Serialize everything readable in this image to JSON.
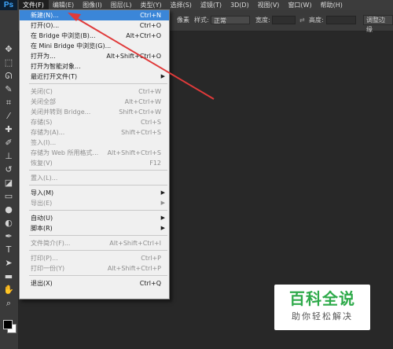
{
  "app": {
    "logo": "Ps"
  },
  "menubar": {
    "items": [
      {
        "label": "文件(F)"
      },
      {
        "label": "编辑(E)"
      },
      {
        "label": "图像(I)"
      },
      {
        "label": "图层(L)"
      },
      {
        "label": "类型(Y)"
      },
      {
        "label": "选择(S)"
      },
      {
        "label": "滤镜(T)"
      },
      {
        "label": "3D(D)"
      },
      {
        "label": "视图(V)"
      },
      {
        "label": "窗口(W)"
      },
      {
        "label": "帮助(H)"
      }
    ]
  },
  "options_bar": {
    "feather_unit": "像素",
    "style_label": "样式:",
    "style_value": "正常",
    "width_label": "宽度:",
    "height_label": "高度:",
    "refine_button": "调整边缘"
  },
  "file_menu": {
    "items": [
      {
        "label": "新建(N)...",
        "shortcut": "Ctrl+N",
        "state": "highlighted"
      },
      {
        "label": "打开(O)...",
        "shortcut": "Ctrl+O",
        "state": "enabled"
      },
      {
        "label": "在 Bridge 中浏览(B)...",
        "shortcut": "Alt+Ctrl+O",
        "state": "enabled"
      },
      {
        "label": "在 Mini Bridge 中浏览(G)...",
        "shortcut": "",
        "state": "enabled"
      },
      {
        "label": "打开为...",
        "shortcut": "Alt+Shift+Ctrl+O",
        "state": "enabled"
      },
      {
        "label": "打开为智能对象...",
        "shortcut": "",
        "state": "enabled"
      },
      {
        "label": "最近打开文件(T)",
        "shortcut": "",
        "state": "enabled",
        "submenu": true
      },
      {
        "separator": true
      },
      {
        "label": "关闭(C)",
        "shortcut": "Ctrl+W",
        "state": "disabled"
      },
      {
        "label": "关闭全部",
        "shortcut": "Alt+Ctrl+W",
        "state": "disabled"
      },
      {
        "label": "关闭并转到 Bridge...",
        "shortcut": "Shift+Ctrl+W",
        "state": "disabled"
      },
      {
        "label": "存储(S)",
        "shortcut": "Ctrl+S",
        "state": "disabled"
      },
      {
        "label": "存储为(A)...",
        "shortcut": "Shift+Ctrl+S",
        "state": "disabled"
      },
      {
        "label": "签入(I)...",
        "shortcut": "",
        "state": "disabled"
      },
      {
        "label": "存储为 Web 所用格式...",
        "shortcut": "Alt+Shift+Ctrl+S",
        "state": "disabled"
      },
      {
        "label": "恢复(V)",
        "shortcut": "F12",
        "state": "disabled"
      },
      {
        "separator": true
      },
      {
        "label": "置入(L)...",
        "shortcut": "",
        "state": "disabled"
      },
      {
        "separator": true
      },
      {
        "label": "导入(M)",
        "shortcut": "",
        "state": "enabled",
        "submenu": true
      },
      {
        "label": "导出(E)",
        "shortcut": "",
        "state": "disabled",
        "submenu": true
      },
      {
        "separator": true
      },
      {
        "label": "自动(U)",
        "shortcut": "",
        "state": "enabled",
        "submenu": true
      },
      {
        "label": "脚本(R)",
        "shortcut": "",
        "state": "enabled",
        "submenu": true
      },
      {
        "separator": true
      },
      {
        "label": "文件简介(F)...",
        "shortcut": "Alt+Shift+Ctrl+I",
        "state": "disabled"
      },
      {
        "separator": true
      },
      {
        "label": "打印(P)...",
        "shortcut": "Ctrl+P",
        "state": "disabled"
      },
      {
        "label": "打印一份(Y)",
        "shortcut": "Alt+Shift+Ctrl+P",
        "state": "disabled"
      },
      {
        "separator": true
      },
      {
        "label": "退出(X)",
        "shortcut": "Ctrl+Q",
        "state": "enabled"
      }
    ]
  },
  "toolbar": {
    "tools": [
      {
        "icon": "move-tool-icon",
        "glyph": "✥"
      },
      {
        "icon": "marquee-tool-icon",
        "glyph": "⬚"
      },
      {
        "icon": "lasso-tool-icon",
        "glyph": "ᘏ"
      },
      {
        "icon": "quick-select-tool-icon",
        "glyph": "✎"
      },
      {
        "icon": "crop-tool-icon",
        "glyph": "⌗"
      },
      {
        "icon": "eyedropper-tool-icon",
        "glyph": "⁄"
      },
      {
        "icon": "healing-brush-tool-icon",
        "glyph": "✚"
      },
      {
        "icon": "brush-tool-icon",
        "glyph": "✐"
      },
      {
        "icon": "clone-stamp-tool-icon",
        "glyph": "⊥"
      },
      {
        "icon": "history-brush-tool-icon",
        "glyph": "↺"
      },
      {
        "icon": "eraser-tool-icon",
        "glyph": "◪"
      },
      {
        "icon": "gradient-tool-icon",
        "glyph": "▭"
      },
      {
        "icon": "blur-tool-icon",
        "glyph": "●"
      },
      {
        "icon": "dodge-tool-icon",
        "glyph": "◐"
      },
      {
        "icon": "pen-tool-icon",
        "glyph": "✒"
      },
      {
        "icon": "type-tool-icon",
        "glyph": "T"
      },
      {
        "icon": "path-select-tool-icon",
        "glyph": "➤"
      },
      {
        "icon": "shape-tool-icon",
        "glyph": "▬"
      },
      {
        "icon": "hand-tool-icon",
        "glyph": "✋"
      },
      {
        "icon": "zoom-tool-icon",
        "glyph": "⌕"
      }
    ]
  },
  "watermark": {
    "title": "百科全说",
    "subtitle": "助你轻松解决"
  },
  "colors": {
    "highlight": "#3b86d8",
    "annotation_arrow": "#e03a3a",
    "watermark_green": "#2eaa4a"
  }
}
